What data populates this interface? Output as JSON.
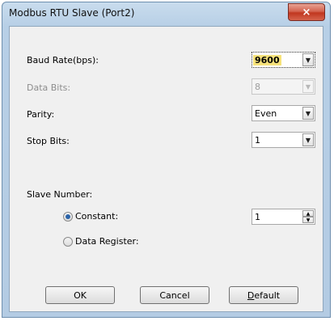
{
  "window": {
    "title": "Modbus RTU Slave (Port2)",
    "close_glyph": "×"
  },
  "fields": {
    "baud_rate": {
      "label": "Baud Rate(bps):",
      "value": "9600"
    },
    "data_bits": {
      "label": "Data Bits:",
      "value": "8"
    },
    "parity": {
      "label": "Parity:",
      "value": "Even"
    },
    "stop_bits": {
      "label": "Stop Bits:",
      "value": "1"
    }
  },
  "slave": {
    "label": "Slave Number:",
    "constant_label": "Constant:",
    "data_register_label": "Data Register:",
    "constant_value": "1",
    "selected": "constant"
  },
  "buttons": {
    "ok": "OK",
    "cancel": "Cancel",
    "default_first": "D",
    "default_rest": "efault"
  },
  "icons": {
    "dropdown": "chevron-down-icon",
    "spin_up": "spin-up-icon",
    "spin_down": "spin-down-icon"
  },
  "colors": {
    "title_bar": "#b7cfe6",
    "close_button": "#c1371f",
    "selection_highlight": "#f6e27a"
  }
}
